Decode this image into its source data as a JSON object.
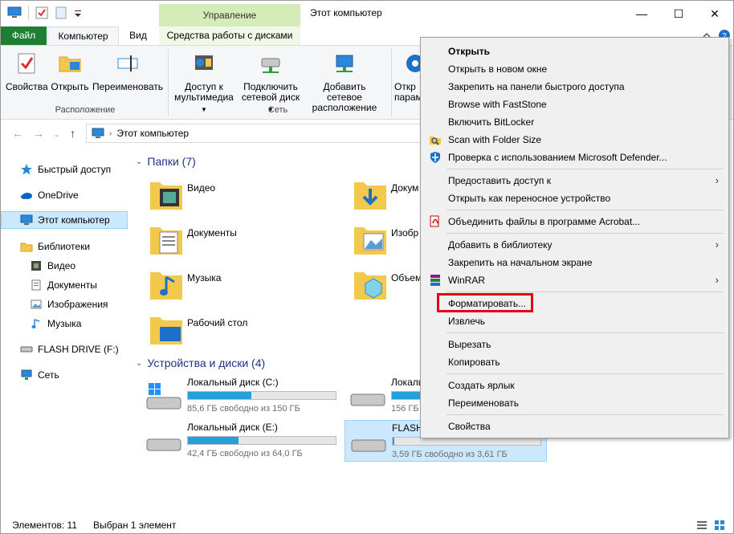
{
  "window": {
    "title": "Этот компьютер",
    "context_tab_header": "Управление",
    "controls": {
      "minimize": "—",
      "maximize": "☐",
      "close": "✕"
    }
  },
  "tabs": {
    "file": "Файл",
    "computer": "Компьютер",
    "view": "Вид",
    "drive_tools": "Средства работы с дисками"
  },
  "ribbon": {
    "properties": "Свойства",
    "open": "Открыть",
    "rename": "Переименовать",
    "group_location": "Расположение",
    "media_access_1": "Доступ к",
    "media_access_2": "мультимедиа",
    "map_drive_1": "Подключить",
    "map_drive_2": "сетевой диск",
    "add_location_1": "Добавить сетевое",
    "add_location_2": "расположение",
    "group_network": "Сеть",
    "open_settings_1": "Откр",
    "open_settings_2": "парам"
  },
  "address": {
    "path": "Этот компьютер"
  },
  "nav": {
    "quick_access": "Быстрый доступ",
    "onedrive": "OneDrive",
    "this_pc": "Этот компьютер",
    "libraries": "Библиотеки",
    "video": "Видео",
    "documents": "Документы",
    "pictures": "Изображения",
    "music": "Музыка",
    "flash": "FLASH DRIVE (F:)",
    "network": "Сеть"
  },
  "folders": {
    "header": "Папки (7)",
    "video": "Видео",
    "downloads": "Докум",
    "documents": "Документы",
    "pictures": "Изобр",
    "music": "Музыка",
    "objects3d": "Объем",
    "desktop": "Рабочий стол"
  },
  "drives": {
    "header": "Устройства и диски (4)",
    "items": [
      {
        "name": "Локальный диск (C:)",
        "free": "85,6 ГБ свободно из 150 ГБ",
        "used_fraction": 0.43
      },
      {
        "name": "Локальный",
        "free": "156 ГБ свободно",
        "used_fraction": 0.3
      },
      {
        "name": "Локальный диск (E:)",
        "free": "42,4 ГБ свободно из 64,0 ГБ",
        "used_fraction": 0.34
      },
      {
        "name": "FLASH",
        "free": "3,59 ГБ свободно из 3,61 ГБ",
        "used_fraction": 0.01
      }
    ]
  },
  "menu": {
    "open": "Открыть",
    "open_new_window": "Открыть в новом окне",
    "pin_quick": "Закрепить на панели быстрого доступа",
    "faststone": "Browse with FastStone",
    "bitlocker": "Включить BitLocker",
    "folder_size": "Scan with Folder Size",
    "defender": "Проверка с использованием Microsoft Defender...",
    "share": "Предоставить доступ к",
    "portable": "Открыть как переносное устройство",
    "acrobat": "Объединить файлы в программе Acrobat...",
    "add_library": "Добавить в библиотеку",
    "pin_start": "Закрепить на начальном экране",
    "winrar": "WinRAR",
    "format": "Форматировать...",
    "eject": "Извлечь",
    "cut": "Вырезать",
    "copy": "Копировать",
    "shortcut": "Создать ярлык",
    "rename": "Переименовать",
    "properties": "Свойства"
  },
  "status": {
    "count": "Элементов: 11",
    "selected": "Выбран 1 элемент"
  },
  "colors": {
    "file_tab": "#1e7e34",
    "context_header": "#d6ecb8",
    "selection": "#cce8ff",
    "drive_bar": "#26a0da",
    "highlight": "#e3001b"
  }
}
